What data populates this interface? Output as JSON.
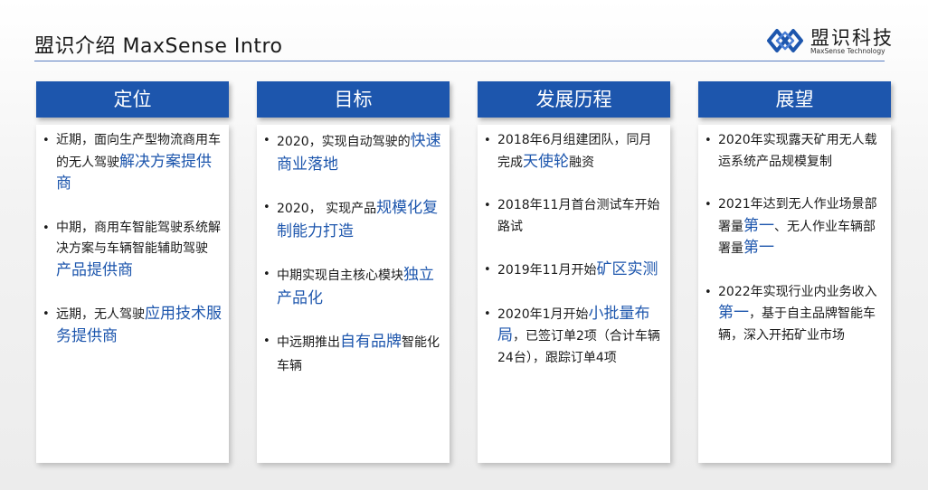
{
  "header": {
    "title": "盟识介绍  MaxSense Intro",
    "logo_cn": "盟识科技",
    "logo_en": "MaxSense Technology",
    "accent": "#1d56ad"
  },
  "columns": [
    {
      "title": "定位",
      "items": [
        {
          "bullet": "•",
          "text": "近期，面向生产型物流商用车的无人驾驶",
          "highlight": "解决方案提供商",
          "after": ""
        },
        {
          "bullet": "•",
          "text": "中期，商用车智能驾驶系统解决方案与车辆智能辅助驾驶",
          "highlight": "产品提供商",
          "after": ""
        },
        {
          "bullet": "•",
          "text": "远期，无人驾驶",
          "highlight": "应用技术服务提供商",
          "after": ""
        }
      ]
    },
    {
      "title": "目标",
      "items": [
        {
          "bullet": "•",
          "text": "2020，实现自动驾驶的",
          "highlight": "快速商业落地",
          "after": ""
        },
        {
          "bullet": "•",
          "text": "2020， 实现产品",
          "highlight": "规模化复制能力打造",
          "after": ""
        },
        {
          "bullet": "•",
          "text": "中期实现自主核心模块",
          "highlight": "独立产品化",
          "after": ""
        },
        {
          "bullet": "•",
          "text": "中远期推出",
          "highlight": "自有品牌",
          "after": "智能化车辆"
        }
      ]
    },
    {
      "title": "发展历程",
      "items": [
        {
          "bullet": "•",
          "text": "2018年6月组建团队，同月完成",
          "highlight": "天使轮",
          "after": "融资"
        },
        {
          "bullet": "•",
          "text": "2018年11月首台测试车开始路试",
          "highlight": "",
          "after": ""
        },
        {
          "bullet": "•",
          "text": "2019年11月开始",
          "highlight": "矿区实测",
          "after": ""
        },
        {
          "bullet": "•",
          "text": "2020年1月开始",
          "highlight": "小批量布局",
          "after": "，已签订单2项（合计车辆24台），跟踪订单4项"
        }
      ]
    },
    {
      "title": "展望",
      "items": [
        {
          "bullet": "•",
          "text": "2020年实现露天矿用无人载运系统产品规模复制",
          "highlight": "",
          "after": ""
        },
        {
          "bullet": "•",
          "text": "2021年达到无人作业场景部署量",
          "highlight": "第一",
          "after": "、无人作业车辆部署量",
          "highlight2": "第一"
        },
        {
          "bullet": "•",
          "text": "2022年实现行业内业务收入",
          "highlight": "第一",
          "after": "，基于自主品牌智能车辆，深入开拓矿业市场"
        }
      ]
    }
  ]
}
